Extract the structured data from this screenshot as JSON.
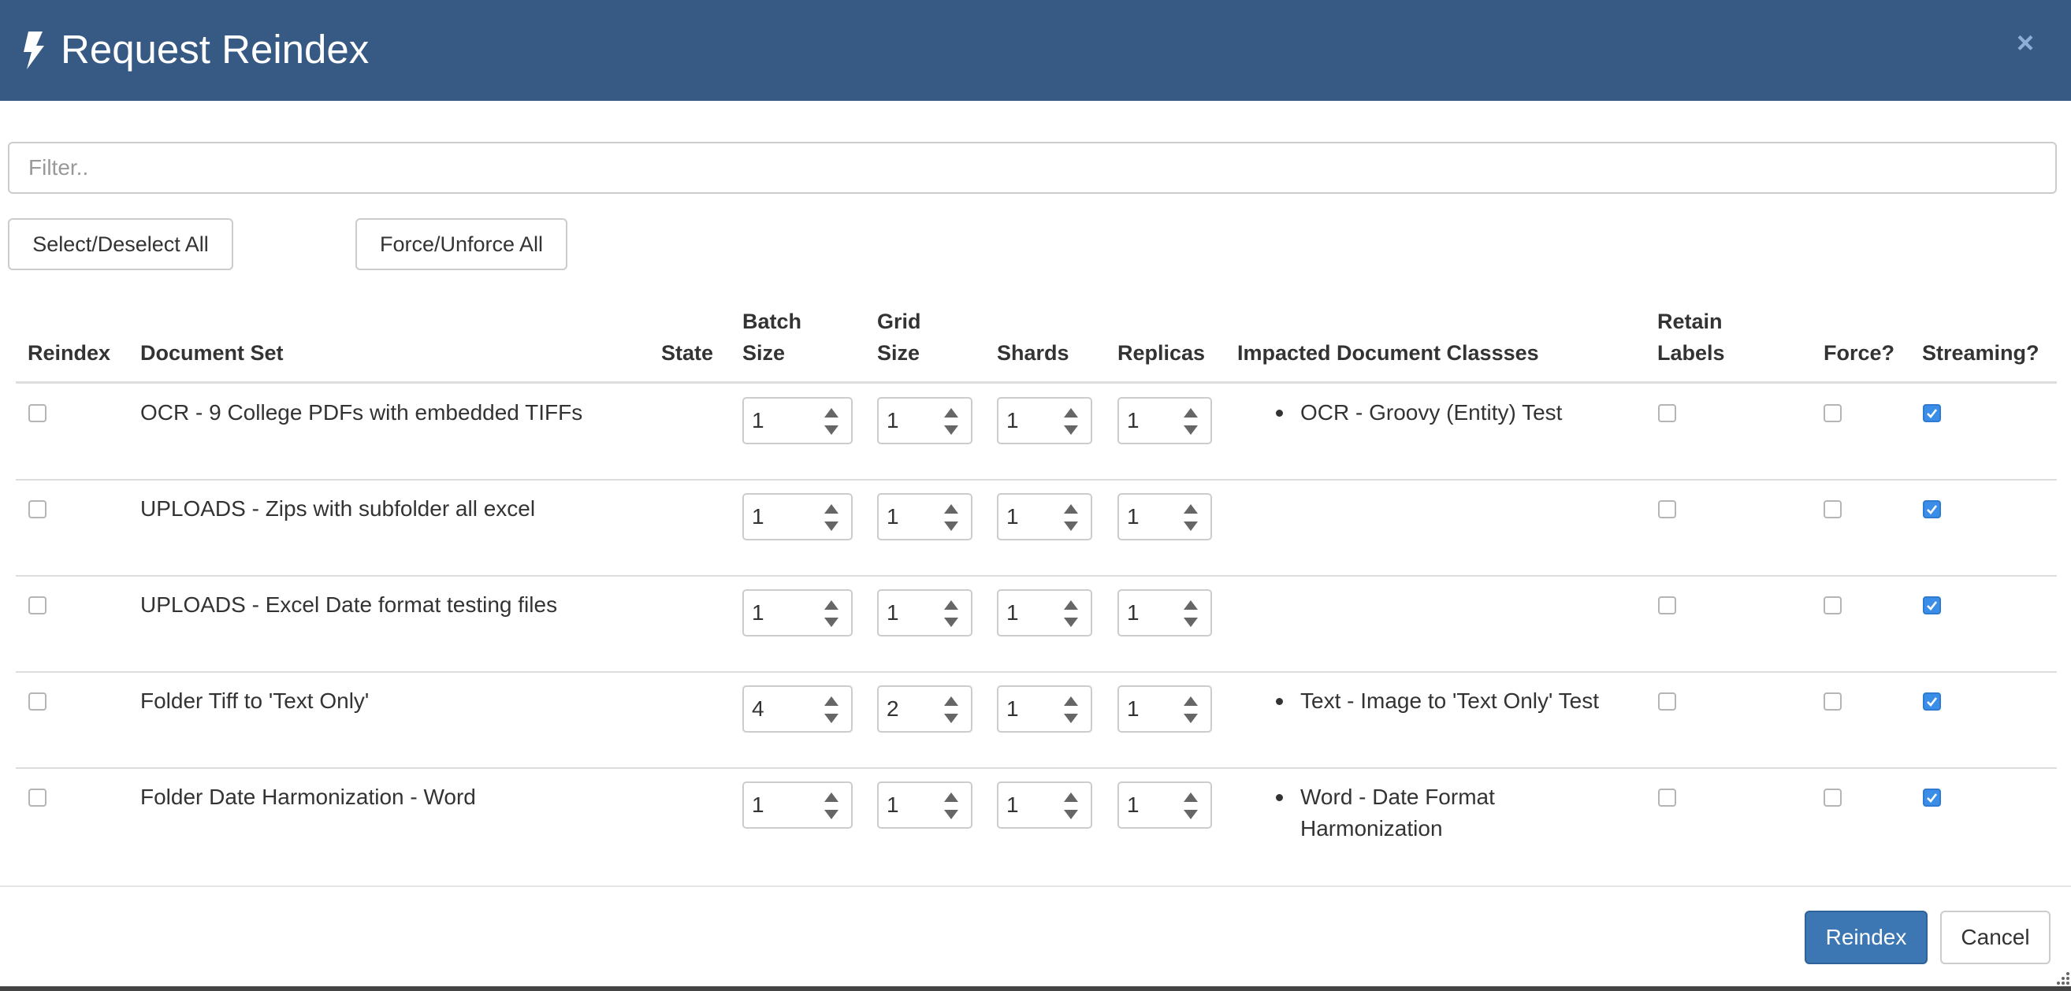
{
  "dialog": {
    "title": "Request Reindex",
    "close_icon": "close-icon",
    "title_icon": "bolt-icon"
  },
  "filter": {
    "placeholder": "Filter..",
    "value": ""
  },
  "toolbar": {
    "select_all_label": "Select/Deselect All",
    "force_all_label": "Force/Unforce All"
  },
  "table": {
    "headers": {
      "reindex": "Reindex",
      "document_set": "Document Set",
      "state": "State",
      "batch_size_1": "Batch",
      "batch_size_2": "Size",
      "grid_size_1": "Grid",
      "grid_size_2": "Size",
      "shards": "Shards",
      "replicas": "Replicas",
      "impacted": "Impacted Document Classses",
      "retain_labels_1": "Retain",
      "retain_labels_2": "Labels",
      "force": "Force?",
      "streaming": "Streaming?"
    },
    "rows": [
      {
        "reindex": false,
        "document_set": "OCR - 9 College PDFs with embedded TIFFs",
        "state": "",
        "batch_size": "1",
        "grid_size": "1",
        "shards": "1",
        "replicas": "1",
        "impacted": [
          "OCR - Groovy (Entity) Test"
        ],
        "retain_labels": false,
        "force": false,
        "streaming": true
      },
      {
        "reindex": false,
        "document_set": "UPLOADS - Zips with subfolder all excel",
        "state": "",
        "batch_size": "1",
        "grid_size": "1",
        "shards": "1",
        "replicas": "1",
        "impacted": [],
        "retain_labels": false,
        "force": false,
        "streaming": true
      },
      {
        "reindex": false,
        "document_set": "UPLOADS - Excel Date format testing files",
        "state": "",
        "batch_size": "1",
        "grid_size": "1",
        "shards": "1",
        "replicas": "1",
        "impacted": [],
        "retain_labels": false,
        "force": false,
        "streaming": true
      },
      {
        "reindex": false,
        "document_set": "Folder Tiff to 'Text Only'",
        "state": "",
        "batch_size": "4",
        "grid_size": "2",
        "shards": "1",
        "replicas": "1",
        "impacted": [
          "Text - Image to 'Text Only' Test"
        ],
        "retain_labels": false,
        "force": false,
        "streaming": true
      },
      {
        "reindex": false,
        "document_set": "Folder Date Harmonization - Word",
        "state": "",
        "batch_size": "1",
        "grid_size": "1",
        "shards": "1",
        "replicas": "1",
        "impacted": [
          "Word - Date Format Harmonization"
        ],
        "impacted_lines": [
          "Word - Date Format",
          "Harmonization"
        ],
        "retain_labels": false,
        "force": false,
        "streaming": true
      }
    ]
  },
  "footer": {
    "reindex_label": "Reindex",
    "cancel_label": "Cancel"
  },
  "colors": {
    "header_bg": "#375a85",
    "primary_button": "#3c77b4",
    "checkbox_checked": "#3b8ee8"
  }
}
